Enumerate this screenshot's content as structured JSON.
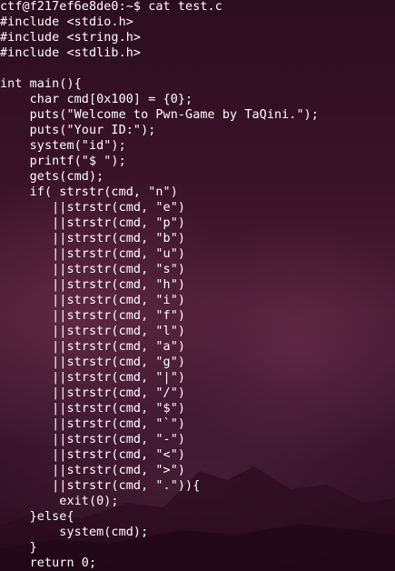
{
  "terminal": {
    "lines": [
      "ctf@f217ef6e8de0:~$ cat test.c",
      "#include <stdio.h>",
      "#include <string.h>",
      "#include <stdlib.h>",
      "",
      "int main(){",
      "    char cmd[0x100] = {0};",
      "    puts(\"Welcome to Pwn-Game by TaQini.\");",
      "    puts(\"Your ID:\");",
      "    system(\"id\");",
      "    printf(\"$ \");",
      "    gets(cmd);",
      "    if( strstr(cmd, \"n\")",
      "       ||strstr(cmd, \"e\")",
      "       ||strstr(cmd, \"p\")",
      "       ||strstr(cmd, \"b\")",
      "       ||strstr(cmd, \"u\")",
      "       ||strstr(cmd, \"s\")",
      "       ||strstr(cmd, \"h\")",
      "       ||strstr(cmd, \"i\")",
      "       ||strstr(cmd, \"f\")",
      "       ||strstr(cmd, \"l\")",
      "       ||strstr(cmd, \"a\")",
      "       ||strstr(cmd, \"g\")",
      "       ||strstr(cmd, \"|\")",
      "       ||strstr(cmd, \"/\")",
      "       ||strstr(cmd, \"$\")",
      "       ||strstr(cmd, \"`\")",
      "       ||strstr(cmd, \"-\")",
      "       ||strstr(cmd, \"<\")",
      "       ||strstr(cmd, \">\")",
      "       ||strstr(cmd, \".\")){",
      "        exit(0);",
      "    }else{",
      "        system(cmd);",
      "    }",
      "    return 0;"
    ],
    "colors": {
      "text": "#ffffff",
      "background": "#3a1228"
    }
  }
}
